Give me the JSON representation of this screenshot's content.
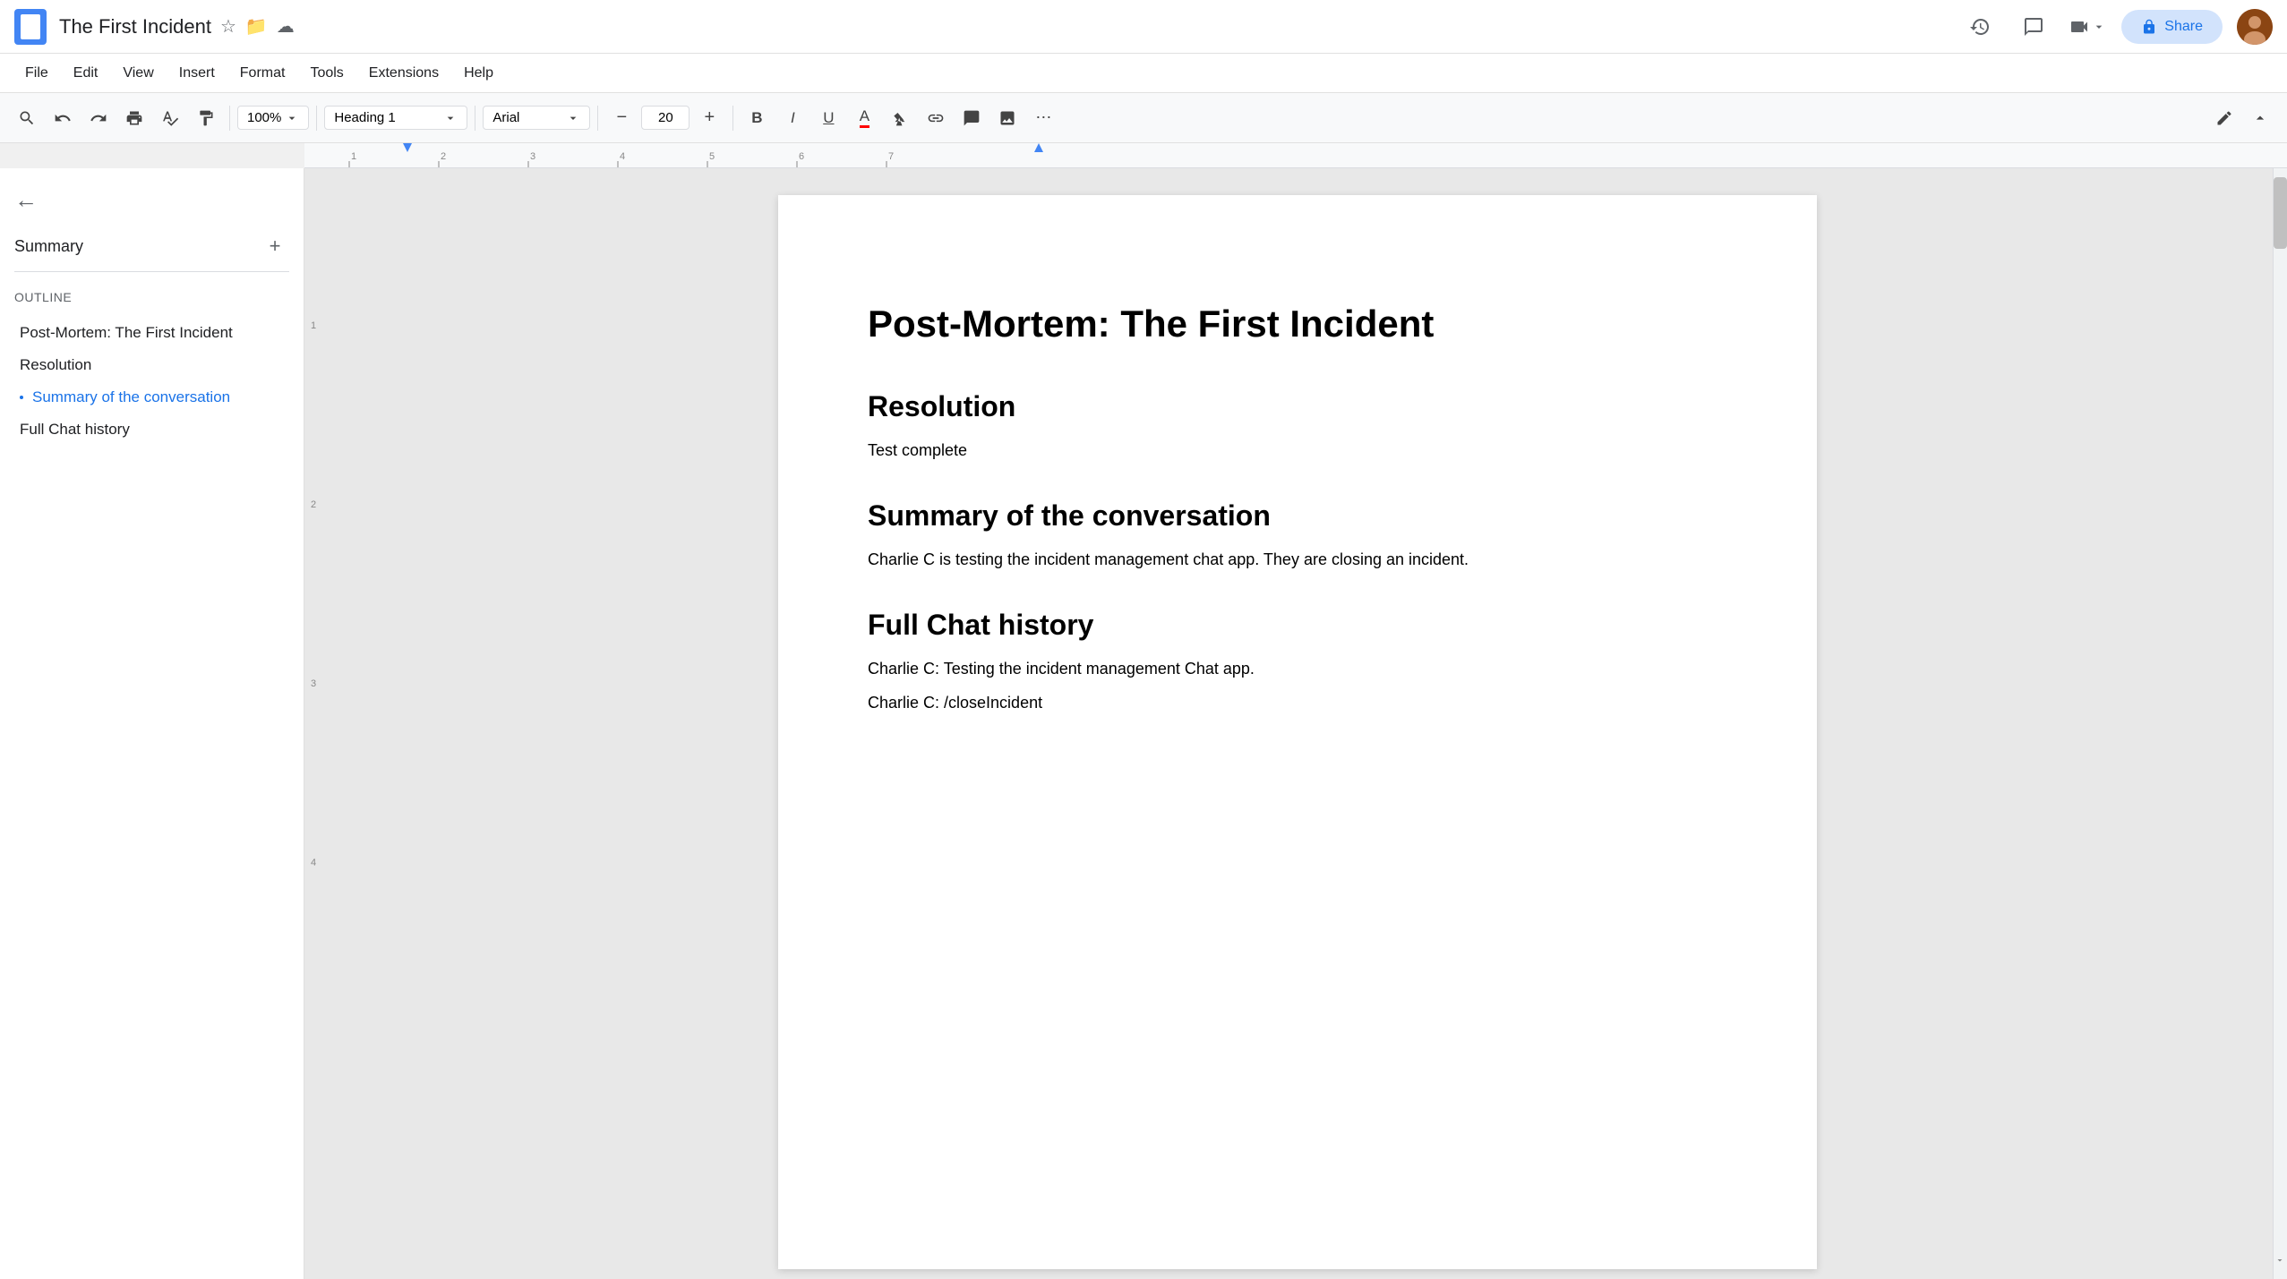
{
  "title_bar": {
    "doc_title": "The First Incident",
    "share_label": "Share",
    "icons": {
      "history": "🕐",
      "comment": "💬",
      "camera": "📷",
      "lock": "🔒"
    }
  },
  "menu_bar": {
    "items": [
      "File",
      "Edit",
      "View",
      "Insert",
      "Format",
      "Tools",
      "Extensions",
      "Help"
    ]
  },
  "toolbar": {
    "zoom": "100%",
    "style": "Heading 1",
    "font": "Arial",
    "font_size": "20",
    "minus_label": "−",
    "plus_label": "+"
  },
  "sidebar": {
    "back_icon": "←",
    "summary_label": "Summary",
    "add_icon": "+",
    "outline_label": "Outline",
    "outline_items": [
      {
        "id": "post-mortem",
        "label": "Post-Mortem: The First Incident",
        "active": false
      },
      {
        "id": "resolution",
        "label": "Resolution",
        "active": false
      },
      {
        "id": "summary-conversation",
        "label": "Summary of the conversation",
        "active": true
      },
      {
        "id": "full-chat",
        "label": "Full Chat history",
        "active": false
      }
    ]
  },
  "document": {
    "title": "Post-Mortem: The First Incident",
    "sections": [
      {
        "heading": "Resolution",
        "body": "Test complete"
      },
      {
        "heading": "Summary of the conversation",
        "body": "Charlie C is testing the incident management chat app. They are closing an incident."
      },
      {
        "heading": "Full Chat history",
        "lines": [
          "Charlie C: Testing the incident management Chat app.",
          "Charlie C: /closeIncident"
        ]
      }
    ]
  }
}
